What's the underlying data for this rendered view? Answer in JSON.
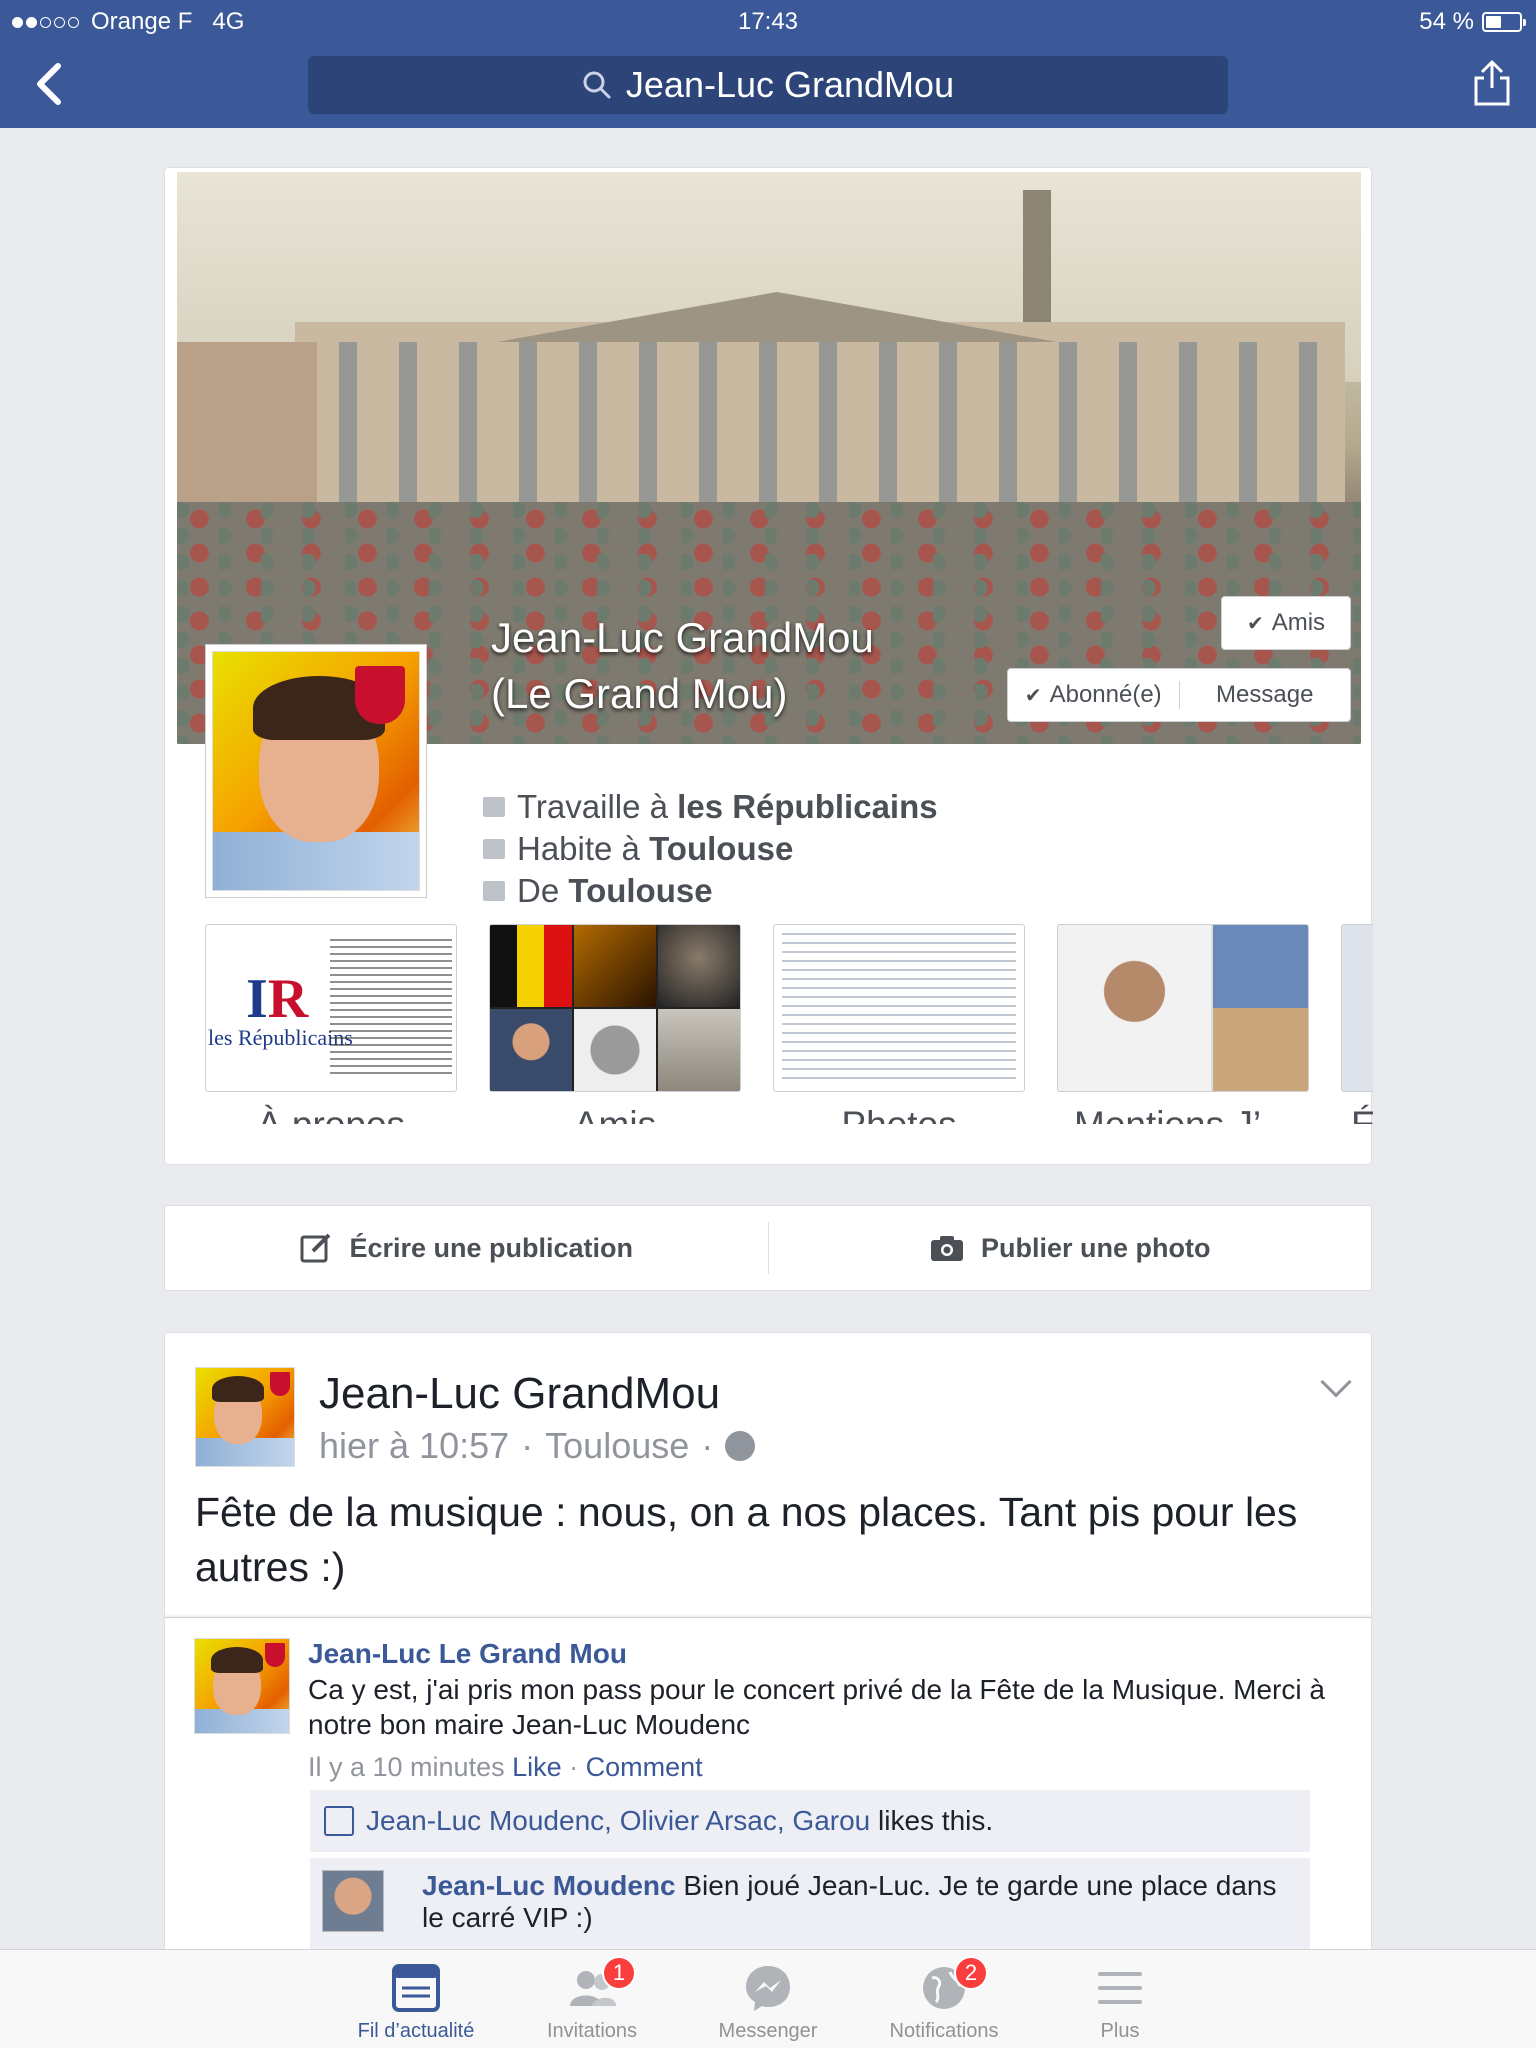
{
  "status": {
    "carrier": "Orange F",
    "network": "4G",
    "time": "17:43",
    "battery_text": "54 %",
    "battery_level": 0.54
  },
  "nav": {
    "search_text": "Jean-Luc GrandMou"
  },
  "profile": {
    "name_line1": "Jean-Luc GrandMou",
    "name_line2": "(Le Grand Mou)",
    "buttons": {
      "friends": "Amis",
      "following": "Abonné(e)",
      "message": "Message"
    },
    "info": {
      "work_prefix": "Travaille à ",
      "work": "les Républicains",
      "lives_prefix": "Habite à ",
      "lives": "Toulouse",
      "from_prefix": "De ",
      "from": "Toulouse"
    },
    "tiles": [
      {
        "label": "À propos"
      },
      {
        "label": "Amis"
      },
      {
        "label": "Photos"
      },
      {
        "label": "Mentions J’..."
      },
      {
        "label": "É"
      }
    ],
    "about_thumb": {
      "logo": "les Républicains",
      "headline": "A TOUS LES FRANÇAIS",
      "footer": "VIVE LA FRANCE !"
    }
  },
  "composer": {
    "write": "Écrire une publication",
    "photo": "Publier une photo"
  },
  "post": {
    "author": "Jean-Luc GrandMou",
    "time": "hier à 10:57",
    "place": "Toulouse",
    "message": "Fête de la musique : nous, on a nos places. Tant pis pour les autres :)",
    "screenshot": {
      "name": "Jean-Luc Le Grand Mou",
      "text": "Ca y est, j'ai pris mon pass pour le concert privé de la Fête de la Musique. Merci à notre bon maire Jean-Luc Moudenc",
      "time": "Il y a 10 minutes",
      "like": "Like",
      "comment": "Comment",
      "likers": "Jean-Luc Moudenc, Olivier Arsac, Garou",
      "likes_suffix": "likes this.",
      "reply_name": "Jean-Luc Moudenc",
      "reply_text": "Bien joué Jean-Luc. Je te garde une place dans le carré VIP :)"
    }
  },
  "tabbar": [
    {
      "label": "Fil d’actualité",
      "icon": "news-feed-icon",
      "active": true
    },
    {
      "label": "Invitations",
      "icon": "friend-requests-icon",
      "badge": "1"
    },
    {
      "label": "Messenger",
      "icon": "messenger-icon"
    },
    {
      "label": "Notifications",
      "icon": "globe-icon",
      "badge": "2"
    },
    {
      "label": "Plus",
      "icon": "menu-icon"
    }
  ],
  "colors": {
    "brand": "#3b5998",
    "badge": "#fa3e3e"
  }
}
